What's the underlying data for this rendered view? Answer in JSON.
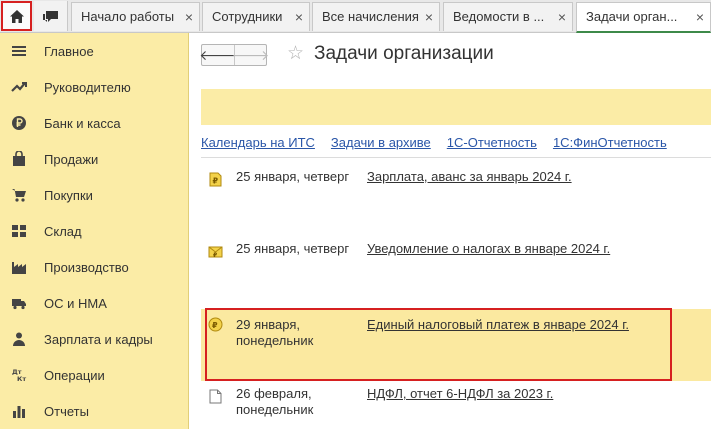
{
  "tabs": [
    {
      "label": "Начало работы"
    },
    {
      "label": "Сотрудники"
    },
    {
      "label": "Все начисления"
    },
    {
      "label": "Ведомости в ..."
    },
    {
      "label": "Задачи орган..."
    }
  ],
  "tab_close_glyph": "×",
  "sidebar": {
    "items": [
      {
        "label": "Главное",
        "icon": "menu-icon"
      },
      {
        "label": "Руководителю",
        "icon": "trend-icon"
      },
      {
        "label": "Банк и касса",
        "icon": "ruble-coin-icon"
      },
      {
        "label": "Продажи",
        "icon": "shopping-bag-icon"
      },
      {
        "label": "Покупки",
        "icon": "cart-icon"
      },
      {
        "label": "Склад",
        "icon": "warehouse-icon"
      },
      {
        "label": "Производство",
        "icon": "factory-icon"
      },
      {
        "label": "ОС и НМА",
        "icon": "truck-icon"
      },
      {
        "label": "Зарплата и кадры",
        "icon": "person-icon"
      },
      {
        "label": "Операции",
        "icon": "dt-kt-icon"
      },
      {
        "label": "Отчеты",
        "icon": "bar-chart-icon"
      }
    ]
  },
  "nav": {
    "back_glyph": "🡐",
    "forward_glyph": "🡒",
    "favorite_glyph": "☆"
  },
  "page": {
    "title": "Задачи организации"
  },
  "links": [
    "Календарь на ИТС",
    "Задачи в архиве",
    "1С-Отчетность",
    "1С:ФинОтчетность"
  ],
  "tasks": [
    {
      "date": "25 января, четверг",
      "title": "Зарплата, аванс за январь 2024 г.",
      "icon": "document-ruble-icon"
    },
    {
      "date": "25 января, четверг",
      "title": "Уведомление о налогах в январе 2024 г.",
      "icon": "envelope-ruble-icon"
    },
    {
      "date": "29 января, понедельник",
      "title": "Единый налоговый платеж в январе 2024 г.",
      "icon": "ruble-coin-icon"
    },
    {
      "date": "26 февраля, понедельник",
      "title": "НДФЛ, отчет 6-НДФЛ за 2023 г.",
      "icon": "document-icon"
    }
  ],
  "colors": {
    "sidebar_bg": "#fbeca6",
    "link": "#2a56a8",
    "highlight": "#d62020",
    "active_tab_line": "#3e8a4a"
  }
}
